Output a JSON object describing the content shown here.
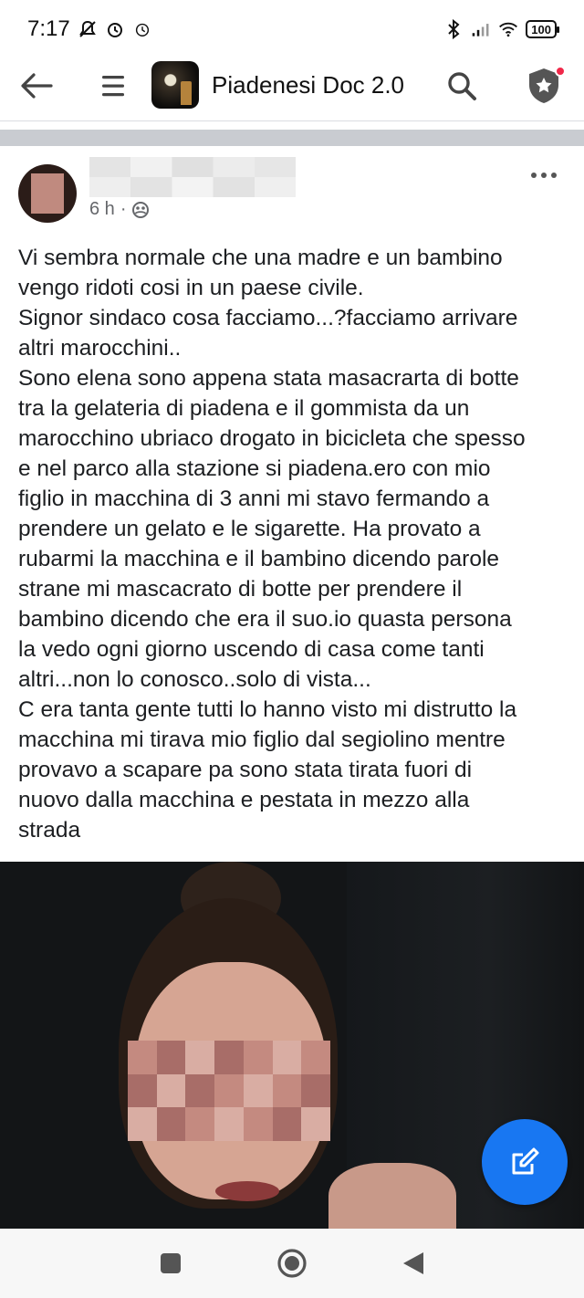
{
  "status_bar": {
    "time": "7:17",
    "battery": "100"
  },
  "app_bar": {
    "title": "Piadenesi Doc 2.0"
  },
  "post": {
    "time": "6 h",
    "separator": "·",
    "text": "Vi sembra normale che una madre e un bambino\nvengo ridoti cosi in un paese civile.\nSignor sindaco cosa facciamo...?facciamo arrivare\naltri marocchini..\nSono elena sono appena stata masacrarta di botte\ntra la gelateria di piadena e il gommista da un\nmarocchino ubriaco drogato in bicicleta che spesso\ne nel parco alla stazione si piadena.ero con mio\nfiglio in macchina di 3 anni mi stavo fermando a\nprendere un gelato e le sigarette. Ha provato a\nrubarmi la macchina e il bambino dicendo parole\nstrane mi mascacrato di botte per prendere il\nbambino dicendo che era il suo.io quasta persona\nla vedo ogni giorno uscendo di casa come tanti\naltri...non lo conosco..solo di vista...\nC era tanta gente tutti lo hanno visto mi distrutto la\nmacchina mi tirava mio figlio dal segiolino mentre\nprovavo a scapare pa sono stata tirata fuori di\nnuovo dalla macchina e pestata in mezzo alla\nstrada"
  },
  "colors": {
    "accent": "#1877f2",
    "notification": "#f02849",
    "meta_text": "#65676b"
  },
  "icons": {
    "back": "arrow-left-icon",
    "menu": "hamburger-menu-icon",
    "search": "search-icon",
    "admin": "shield-star-icon",
    "more": "more-horizontal-icon",
    "privacy": "group-members-icon",
    "compose": "edit-icon"
  }
}
